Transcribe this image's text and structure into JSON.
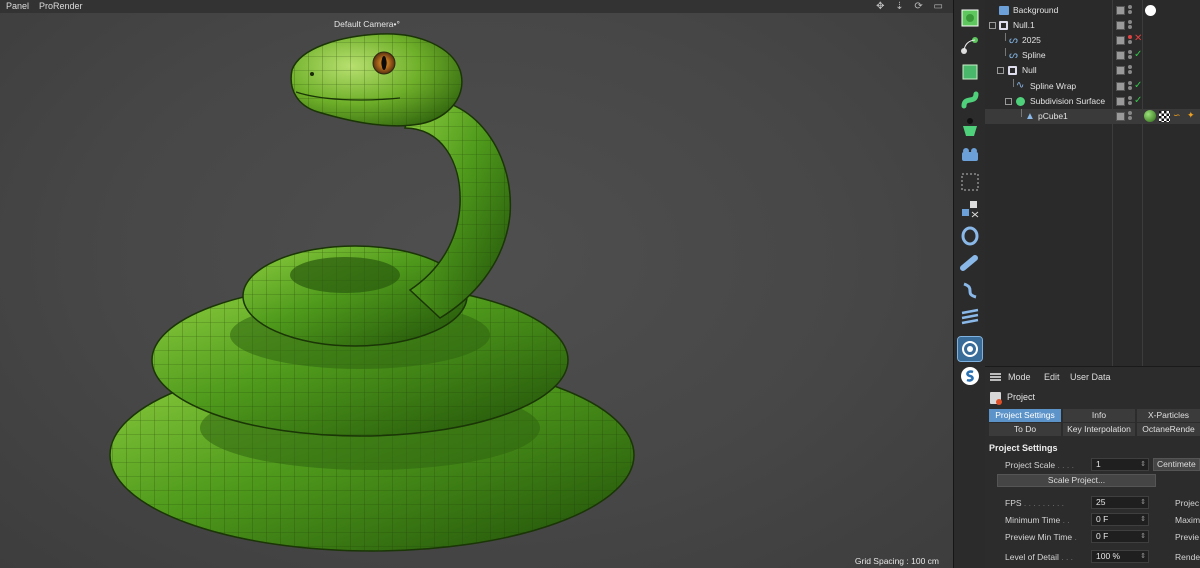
{
  "viewport": {
    "menu": [
      "Panel",
      "ProRender"
    ],
    "nav_icons": "✥ ⇣ ⟳ ▭",
    "camera": "Default Camera",
    "camera_marker": "•°",
    "grid_spacing": "Grid Spacing : 100 cm"
  },
  "toolbar": {
    "tools": [
      "cube-primitive-icon",
      "spline-pen-icon",
      "generator-icon",
      "deformer-icon",
      "figure-icon",
      "camera-icon",
      "selection-icon",
      "layout-icon",
      "twist-icon",
      "bend-icon",
      "wave-icon",
      "layers-icon",
      "disabled-tool-icon",
      "settings-icon",
      "script-icon"
    ]
  },
  "objects": {
    "rows": [
      {
        "name": "Background",
        "tag": "white-circle"
      },
      {
        "name": "Null.1",
        "tag": ""
      },
      {
        "name": "2025",
        "tag": "cross"
      },
      {
        "name": "Spline",
        "tag": "check"
      },
      {
        "name": "Null",
        "tag": ""
      },
      {
        "name": "Spline Wrap",
        "tag": "check"
      },
      {
        "name": "Subdivision Surface",
        "tag": "check"
      },
      {
        "name": "pCube1",
        "tag": "material-tags"
      }
    ]
  },
  "attributes": {
    "menu": [
      "Mode",
      "Edit",
      "User Data"
    ],
    "object_label": "Project",
    "tabs_row1": [
      "Project Settings",
      "Info",
      "X-Particles"
    ],
    "tabs_row2": [
      "To Do",
      "Key Interpolation",
      "OctaneRende"
    ],
    "section": "Project Settings",
    "fields": {
      "project_scale": {
        "label": "Project Scale",
        "dots": " . . . .",
        "value": "1",
        "unit": "Centimete"
      },
      "scale_button": "Scale Project...",
      "fps": {
        "label": "FPS",
        "dots": " . . . . . . . . .",
        "value": "25",
        "right": "Projec"
      },
      "min_time": {
        "label": "Minimum Time",
        "dots": " . .",
        "value": "0 F",
        "right": "Maxim"
      },
      "preview_min": {
        "label": "Preview Min Time",
        "dots": " .",
        "value": "0 F",
        "right": "Previe"
      },
      "lod": {
        "label": "Level of Detail",
        "dots": " . . .",
        "value": "100 %",
        "right": "Rende"
      }
    }
  },
  "colors": {
    "accent": "#5c93c9",
    "check": "#35c24a",
    "cross": "#e04040",
    "snake": "#4f9a1c"
  }
}
